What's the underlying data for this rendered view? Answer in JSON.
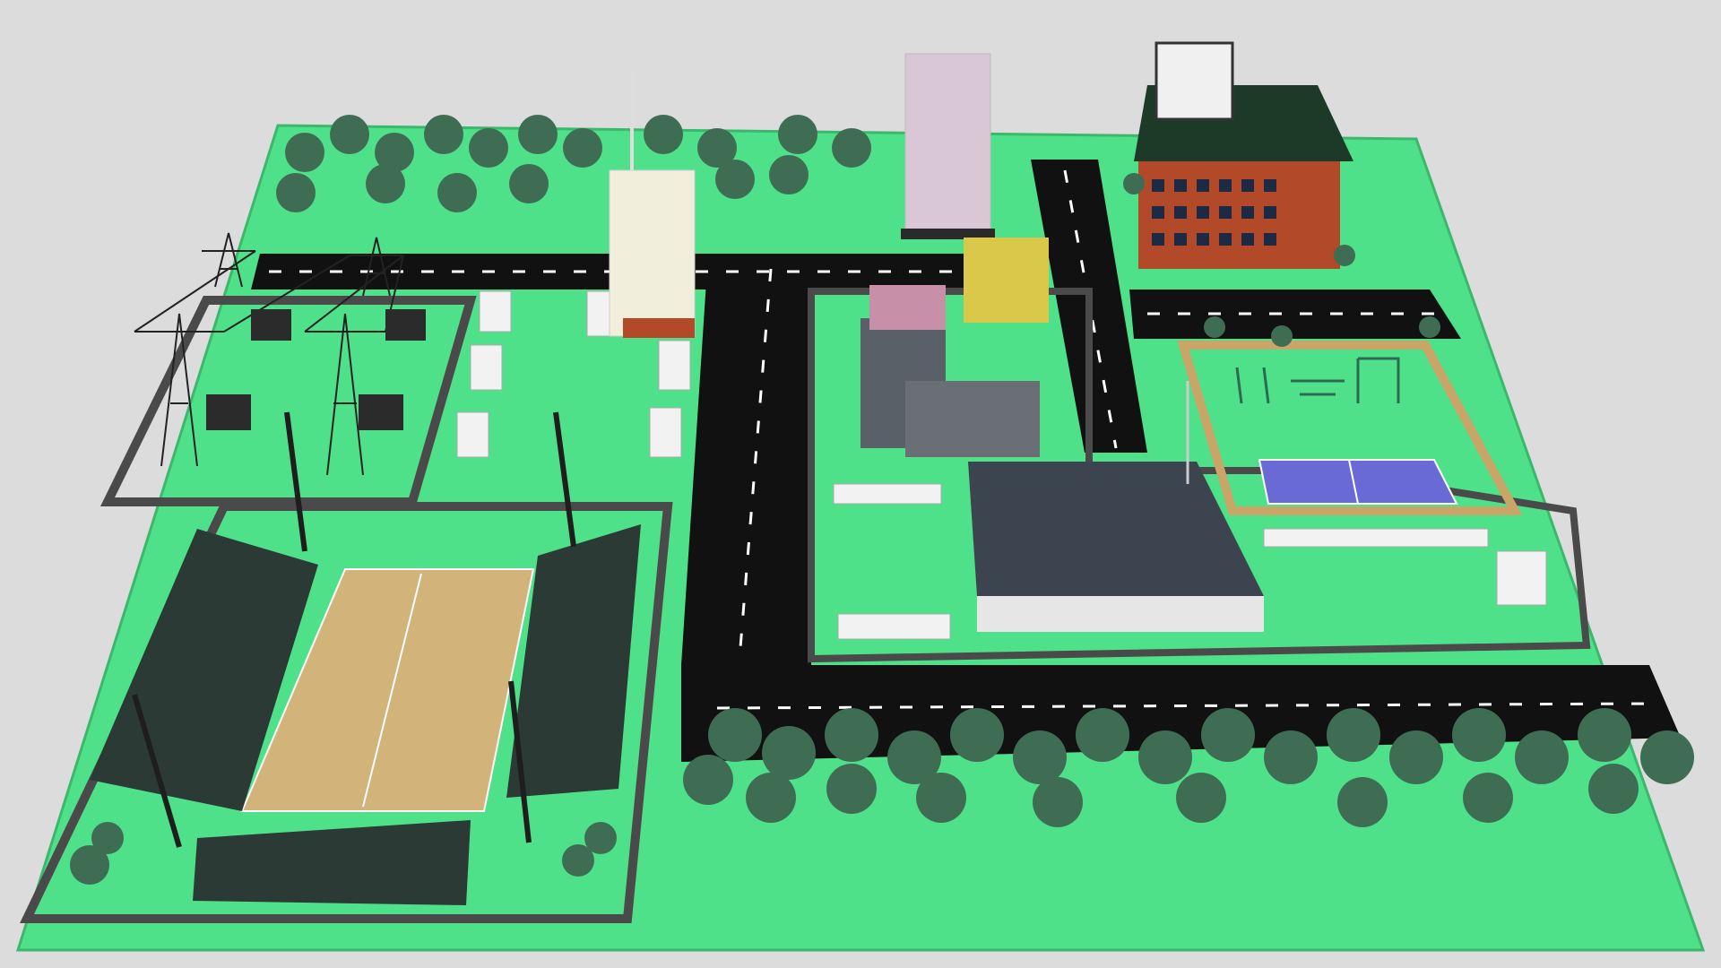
{
  "scene": {
    "colors": {
      "background": "#dcdcdc",
      "ground": "#4fe08a",
      "ground_edge": "#3bb86c",
      "road": "#111111",
      "road_edge": "#555555",
      "lane_marking": "#ffffff",
      "wall": "#4a4a4a",
      "tree_canopy": "#3f6d54",
      "tree_trunk": "#5a3a22",
      "court_surface": "#d2b47a",
      "tennis_court": "#6a6ad6",
      "roof": "#3c4450",
      "brick": "#b24a2a",
      "red_building_roof": "#1d3a28",
      "tower_light": "#f2eedc",
      "tower_pink": "#d9c7d6",
      "tower_dark": "#2a2a2a",
      "stands": "#2b3a34",
      "canopy": "#f2f2f2",
      "playground_border": "#c9a567"
    },
    "elements": [
      "ground-platform",
      "power-substation",
      "stadium",
      "road-network",
      "residential-towers",
      "office-buildings",
      "warehouse",
      "playground",
      "tennis-court",
      "tree-rows",
      "billboard-building"
    ]
  }
}
